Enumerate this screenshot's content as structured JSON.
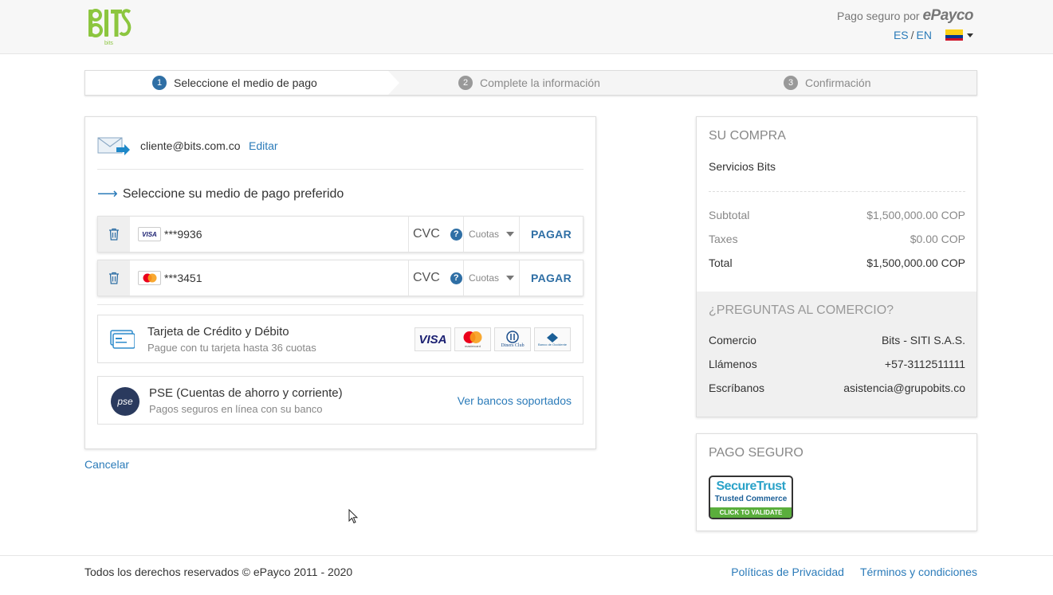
{
  "header": {
    "logo_alt": "BITS",
    "secure_prefix": "Pago seguro por",
    "secure_brand": "ePayco",
    "lang_es": "ES",
    "lang_sep": "/",
    "lang_en": "EN"
  },
  "stepper": {
    "steps": [
      {
        "num": "1",
        "label": "Seleccione el medio de pago",
        "active": true
      },
      {
        "num": "2",
        "label": "Complete la información",
        "active": false
      },
      {
        "num": "3",
        "label": "Confirmación",
        "active": false
      }
    ]
  },
  "payment": {
    "email": "cliente@bits.com.co",
    "edit_label": "Editar",
    "section_title": "Seleccione su medio de pago preferido",
    "saved_cards": [
      {
        "brand": "visa-icon",
        "brand_text": "VISA",
        "masked": "***9936",
        "cvc_placeholder": "CVC",
        "cuotas": "Cuotas",
        "pay_label": "PAGAR"
      },
      {
        "brand": "mastercard-icon",
        "brand_text": "",
        "masked": "***3451",
        "cvc_placeholder": "CVC",
        "cuotas": "Cuotas",
        "pay_label": "PAGAR"
      }
    ],
    "methods": {
      "card": {
        "title": "Tarjeta de Crédito y Débito",
        "subtitle": "Pague con tu tarjeta hasta 36 cuotas",
        "brands": [
          "VISA",
          "mastercard",
          "Diners Club",
          "Banco de Occidente"
        ]
      },
      "pse": {
        "title": "PSE (Cuentas de ahorro y corriente)",
        "subtitle": "Pagos seguros en línea con su banco",
        "link": "Ver bancos soportados",
        "icon_text": "pse"
      }
    },
    "cancel_label": "Cancelar"
  },
  "summary": {
    "heading": "SU COMPRA",
    "item": "Servicios Bits",
    "subtotal_label": "Subtotal",
    "subtotal_value": "$1,500,000.00 COP",
    "taxes_label": "Taxes",
    "taxes_value": "$0.00 COP",
    "total_label": "Total",
    "total_value": "$1,500,000.00 COP"
  },
  "questions": {
    "heading": "¿PREGUNTAS AL COMERCIO?",
    "rows": [
      {
        "label": "Comercio",
        "value": "Bits - SITI S.A.S."
      },
      {
        "label": "Llámenos",
        "value": "+57-3112511111"
      },
      {
        "label": "Escríbanos",
        "value": "asistencia@grupobits.co"
      }
    ]
  },
  "secure": {
    "heading": "PAGO SEGURO",
    "badge_top": "SecureTrust",
    "badge_mid": "Trusted Commerce",
    "badge_bottom": "CLICK TO VALIDATE"
  },
  "footer": {
    "copyright": "Todos los derechos reservados © ePayco 2011 - 2020",
    "privacy": "Políticas de Privacidad",
    "terms": "Términos y condiciones"
  },
  "colors": {
    "accent": "#2b7bb9",
    "step_active": "#2f6fa5",
    "logo_green": "#8cc63f"
  }
}
